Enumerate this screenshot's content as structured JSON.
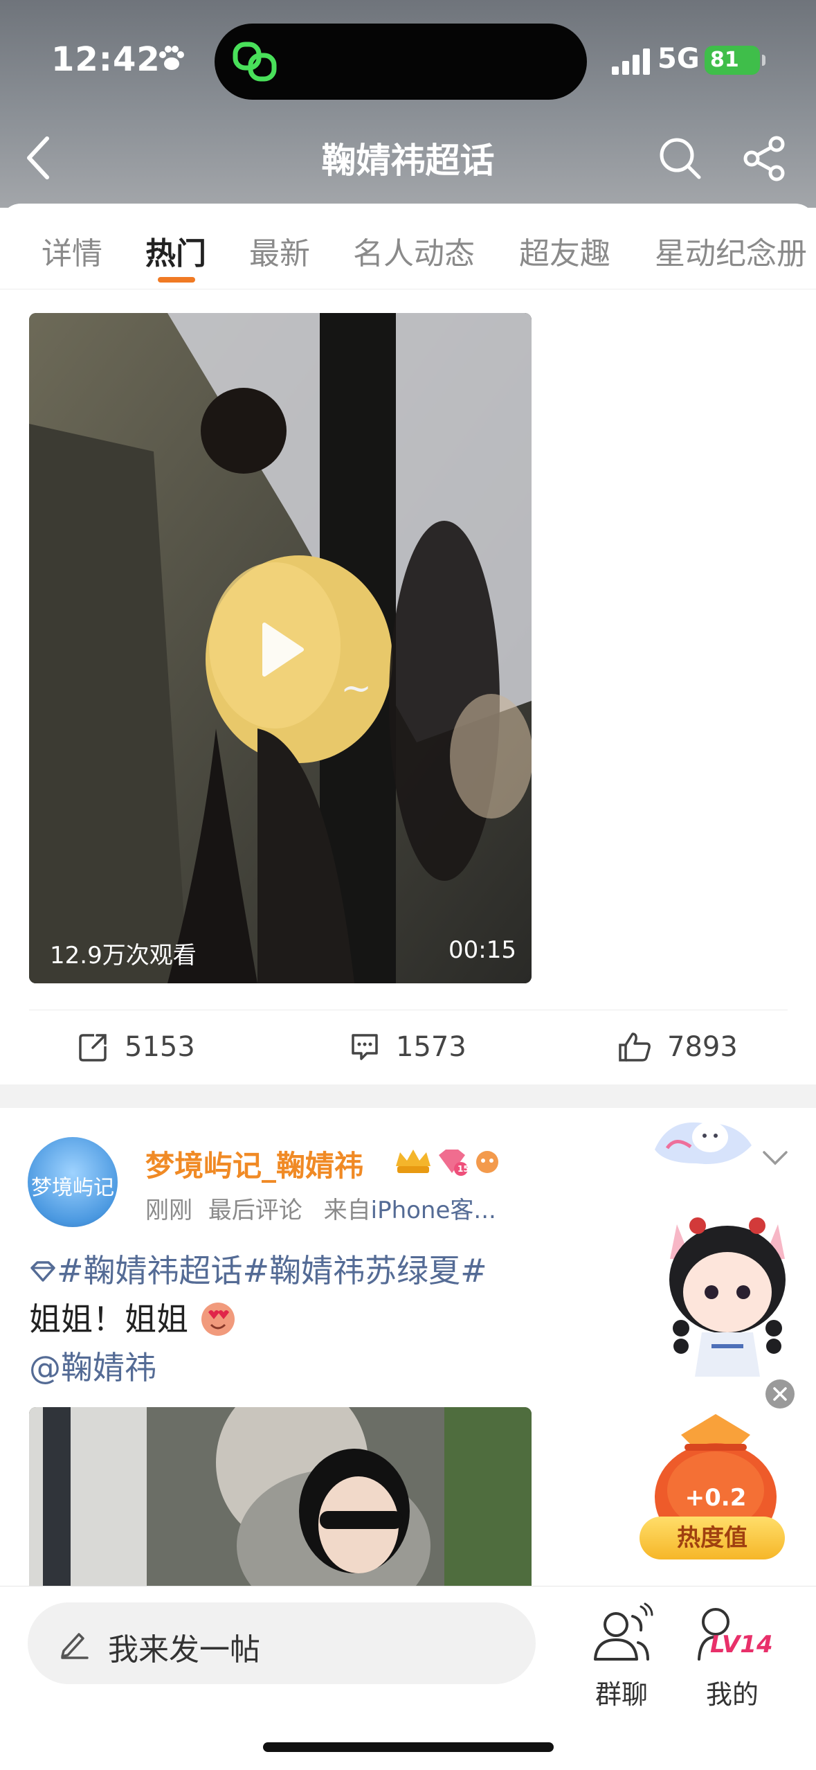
{
  "status_bar": {
    "time": "12:42",
    "network": "5G",
    "battery": "81"
  },
  "header": {
    "title": "鞠婧祎超话"
  },
  "tabs": [
    {
      "label": "详情",
      "active": false
    },
    {
      "label": "热门",
      "active": true
    },
    {
      "label": "最新",
      "active": false
    },
    {
      "label": "名人动态",
      "active": false
    },
    {
      "label": "超友趣",
      "active": false
    },
    {
      "label": "星动纪念册",
      "active": false
    }
  ],
  "video_post": {
    "views": "12.9万次观看",
    "duration": "00:15",
    "share_count": "5153",
    "comment_count": "1573",
    "like_count": "7893"
  },
  "post": {
    "username": "梦境屿记_鞠婧祎",
    "avatar_text": "梦境屿记",
    "level_badge": "15",
    "time": "刚刚",
    "activity": "最后评论",
    "source": "来自iPhone客...",
    "source_prefix": "来自",
    "source_name": "iPhone客...",
    "topics": "#鞠婧祎超话#鞠婧祎苏绿夏#",
    "text": "姐姐！姐姐",
    "mention": "@鞠婧祎"
  },
  "floating": {
    "heat_plus": "+0.2",
    "heat_label": "热度值"
  },
  "bottom_bar": {
    "compose_placeholder": "我来发一帖",
    "group_chat_label": "群聊",
    "mine_label": "我的",
    "level": "LV14"
  },
  "icons": [
    "paw-icon",
    "app-link-icon",
    "signal-icon",
    "back-icon",
    "search-icon",
    "share-icon",
    "play-icon",
    "repost-icon",
    "comment-icon",
    "like-icon",
    "chevron-down-icon",
    "diamond-icon",
    "pen-icon",
    "group-chat-icon",
    "profile-icon",
    "close-icon"
  ],
  "colors": {
    "accent": "#f07a24",
    "topic_link": "#546b95",
    "username": "#f08a25",
    "battery": "#3fbe4a"
  }
}
